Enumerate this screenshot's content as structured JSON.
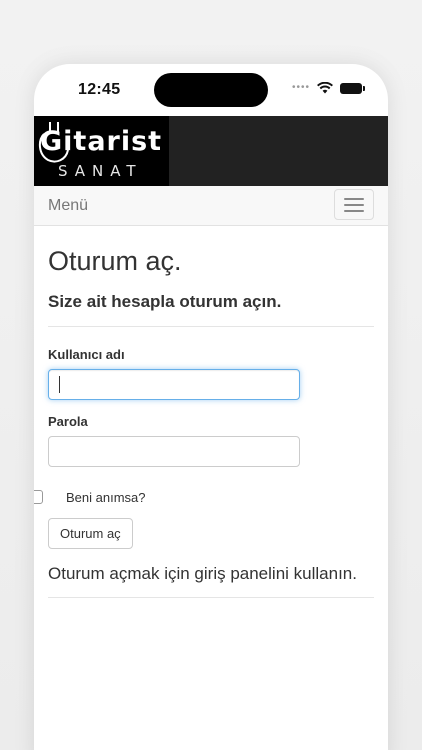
{
  "status_bar": {
    "time": "12:45",
    "icons": [
      "signal-dots-icon",
      "wifi-icon",
      "battery-icon"
    ]
  },
  "header": {
    "logo_text_top": "Gitarist",
    "logo_text_bottom": "SANAT",
    "background": "#222222"
  },
  "navbar": {
    "menu_label": "Menü",
    "toggle_icon": "hamburger-icon"
  },
  "login": {
    "title": "Oturum aç.",
    "subtitle": "Size ait hesapla oturum açın.",
    "username_label": "Kullanıcı adı",
    "username_value": "",
    "password_label": "Parola",
    "password_value": "",
    "remember_label": "Beni anımsa?",
    "remember_checked": false,
    "submit_label": "Oturum aç",
    "help_text": "Oturum açmak için giriş panelini kullanın."
  },
  "colors": {
    "focus_border": "#66afe9",
    "text": "#333333",
    "navbar_bg": "#f8f8f8"
  }
}
